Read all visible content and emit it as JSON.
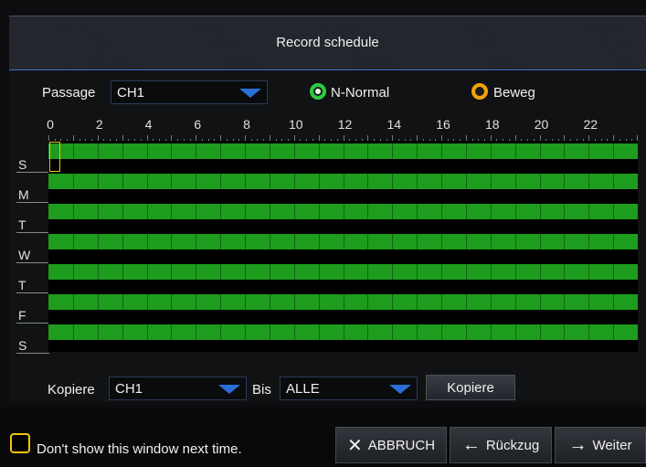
{
  "window": {
    "title": "Record schedule"
  },
  "channel": {
    "label": "Passage",
    "value": "CH1"
  },
  "modes": [
    {
      "label": "N-Normal",
      "color": "#2ecc40",
      "selected": true
    },
    {
      "label": "Beweg",
      "color": "#f2a20a",
      "selected": false
    }
  ],
  "hours": [
    "0",
    "2",
    "4",
    "6",
    "8",
    "10",
    "12",
    "14",
    "16",
    "18",
    "20",
    "22"
  ],
  "days": [
    "S",
    "M",
    "T",
    "W",
    "T",
    "F",
    "S"
  ],
  "schedule_color": "#1d9c1d",
  "copy": {
    "label": "Kopiere",
    "source": "CH1",
    "to_label": "Bis",
    "target": "ALLE",
    "button": "Kopiere"
  },
  "footer": {
    "dont_show": "Don't show this window next time.",
    "cancel": "ABBRUCH",
    "back": "Rückzug",
    "next": "Weiter"
  }
}
